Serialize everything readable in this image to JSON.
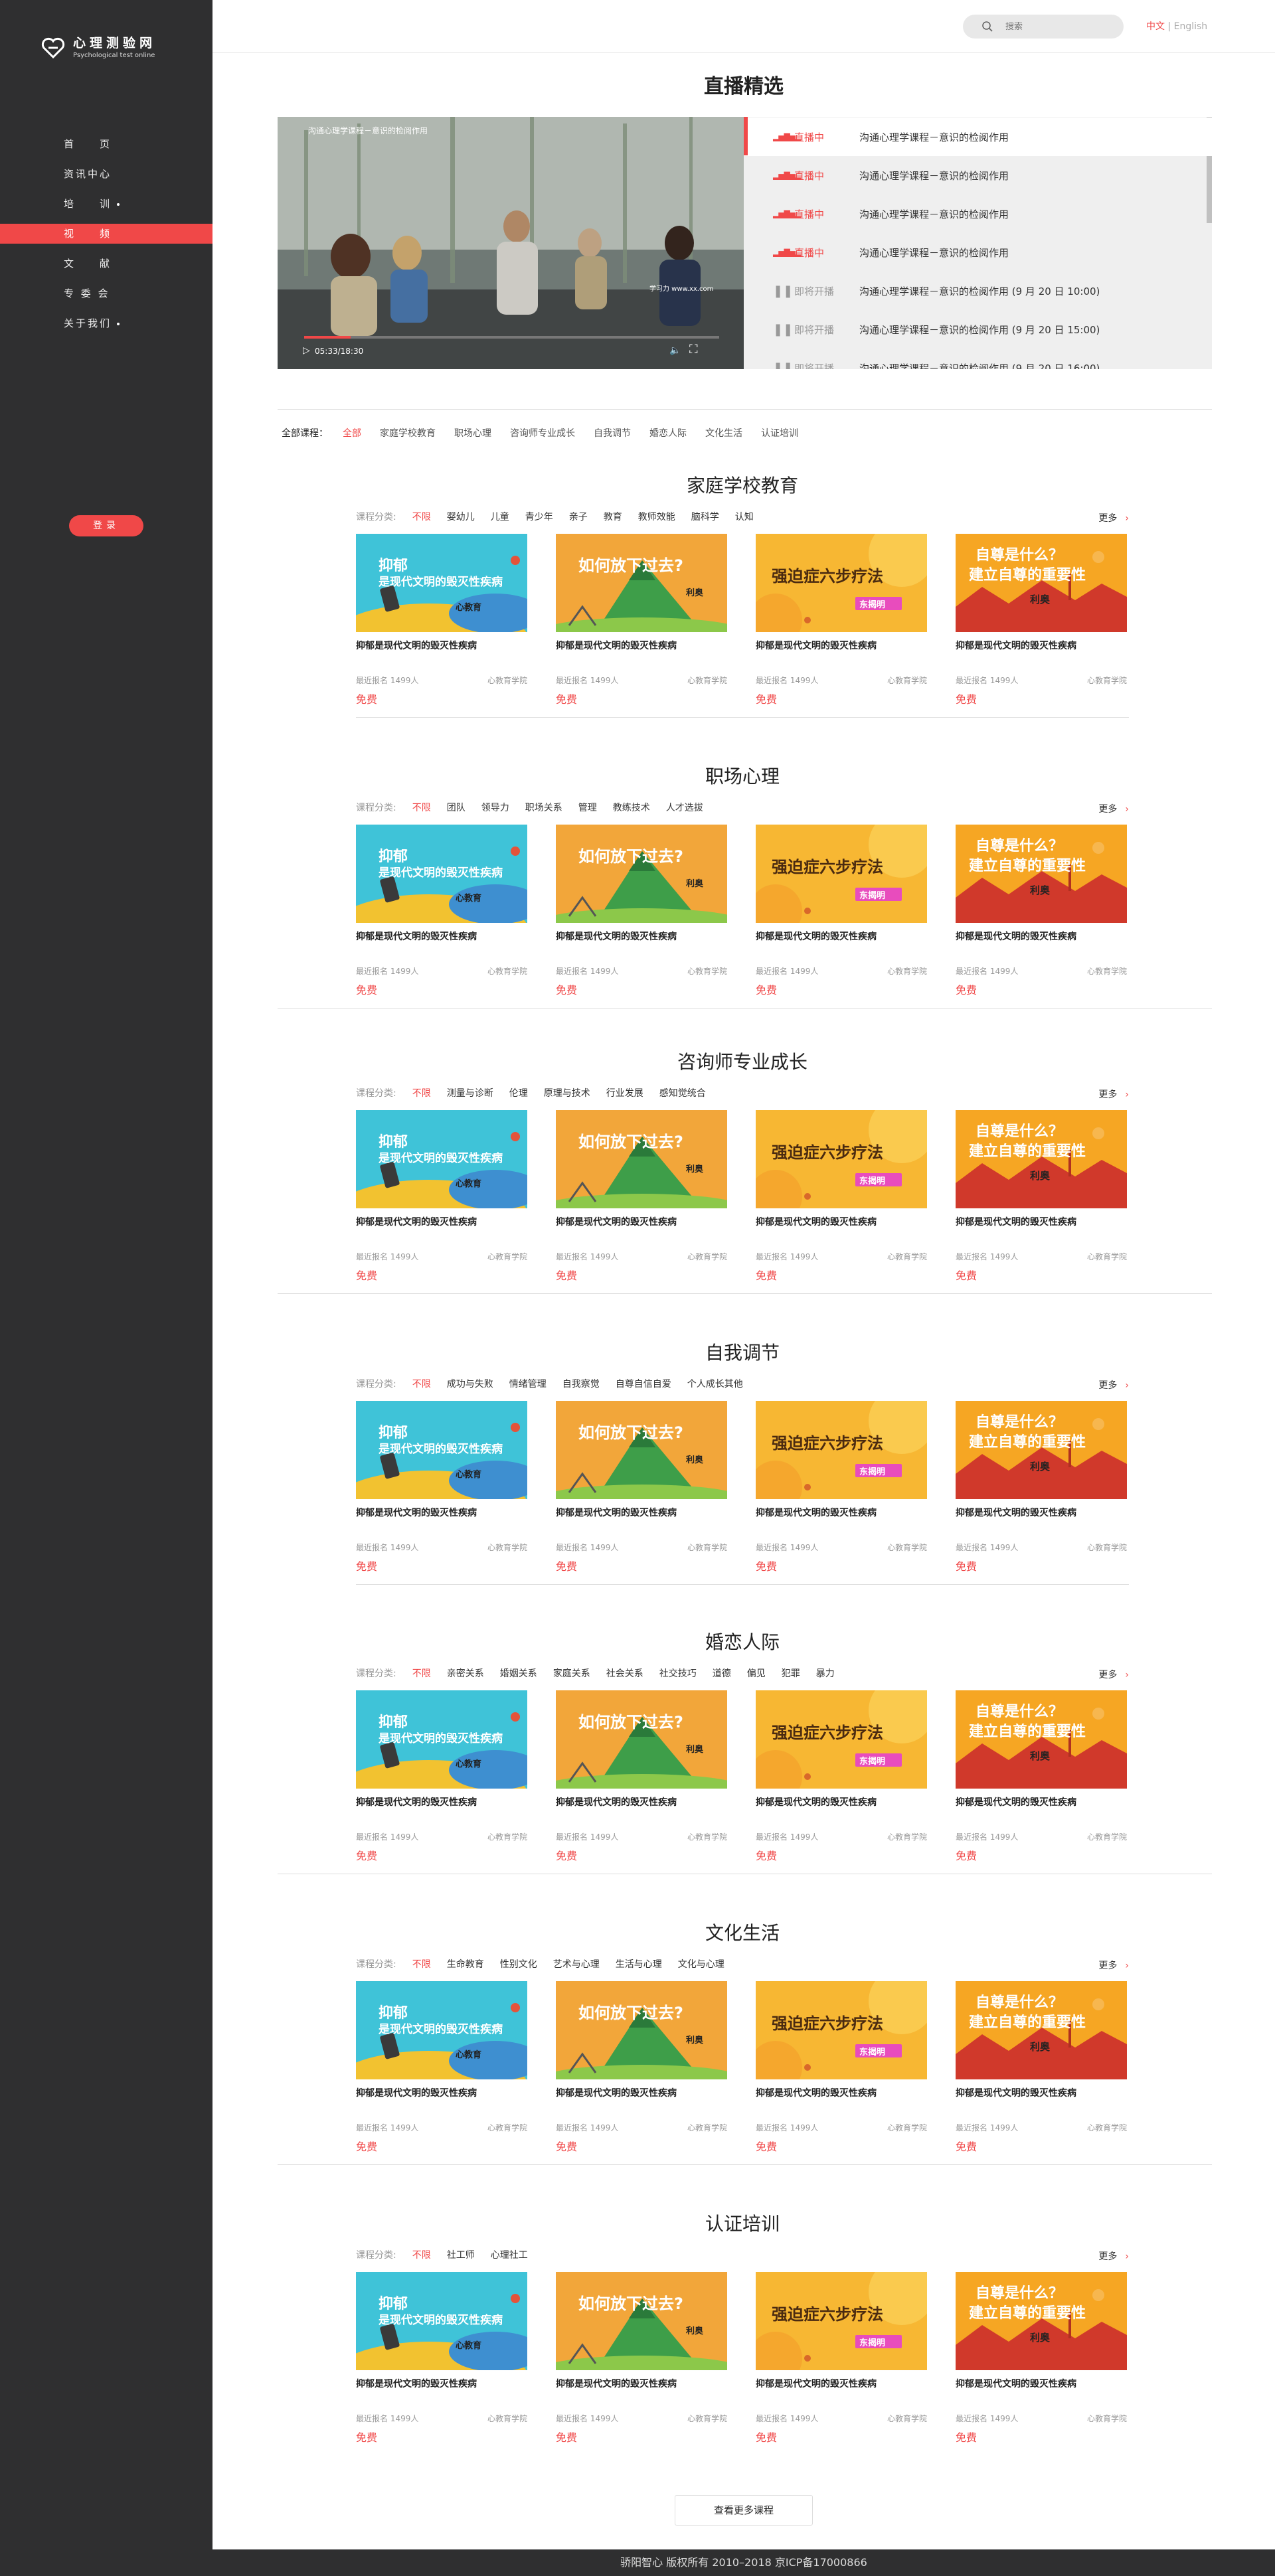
{
  "site": {
    "name": "心理测验网",
    "subtitle": "Psychological test online"
  },
  "nav": [
    {
      "label": "首　　页",
      "dot": false
    },
    {
      "label": "资讯中心",
      "dot": false
    },
    {
      "label": "培　　训",
      "dot": true
    },
    {
      "label": "视　　频",
      "dot": false,
      "active": true
    },
    {
      "label": "文　　献",
      "dot": false
    },
    {
      "label": "专 委 会",
      "dot": false
    },
    {
      "label": "关于我们",
      "dot": true
    }
  ],
  "login_label": "登录",
  "search": {
    "placeholder": "搜索"
  },
  "lang": {
    "zh": "中文",
    "sep": "|",
    "en": "English"
  },
  "live": {
    "title": "直播精选",
    "video_title": "沟通心理学课程－意识的检阅作用",
    "time": "05:33/18:30",
    "watermark": "学习力  www.xx.com",
    "items": [
      {
        "status": "直播中",
        "title": "沟通心理学课程－意识的检阅作用",
        "type": "live"
      },
      {
        "status": "直播中",
        "title": "沟通心理学课程－意识的检阅作用",
        "type": "live"
      },
      {
        "status": "直播中",
        "title": "沟通心理学课程－意识的检阅作用",
        "type": "live"
      },
      {
        "status": "直播中",
        "title": "沟通心理学课程－意识的检阅作用",
        "type": "live"
      },
      {
        "status": "即将开播",
        "title": "沟通心理学课程－意识的检阅作用 (9 月 20 日 10:00)",
        "type": "soon"
      },
      {
        "status": "即将开播",
        "title": "沟通心理学课程－意识的检阅作用 (9 月 20 日 15:00)",
        "type": "soon"
      },
      {
        "status": "即将开播",
        "title": "沟通心理学课程－意识的检阅作用 (9 月 20 日 16:00)",
        "type": "soon"
      }
    ]
  },
  "all_courses": {
    "label": "全部课程：",
    "items": [
      "全部",
      "家庭学校教育",
      "职场心理",
      "咨询师专业成长",
      "自我调节",
      "婚恋人际",
      "文化生活",
      "认证培训"
    ]
  },
  "course_card": {
    "title": "抑郁是现代文明的毁灭性疾病",
    "enroll": "最近报名 1499人",
    "org": "心教育学院",
    "price": "免费",
    "thumbs": [
      {
        "line1": "抑郁",
        "line2": "是现代文明的毁灭性疾病",
        "tag": "心教育"
      },
      {
        "line1": "如何放下过去?",
        "tag": "利奥"
      },
      {
        "line1": "强迫症六步疗法",
        "tag": "东揭明"
      },
      {
        "line1": "自尊是什么？",
        "line2": "建立自尊的重要性",
        "tag": "利奥"
      }
    ]
  },
  "cat_label": "课程分类:",
  "more_label": "更多",
  "sections": [
    {
      "title": "家庭学校教育",
      "cats": [
        "不限",
        "婴幼儿",
        "儿童",
        "青少年",
        "亲子",
        "教育",
        "教师效能",
        "脑科学",
        "认知"
      ]
    },
    {
      "title": "职场心理",
      "cats": [
        "不限",
        "团队",
        "领导力",
        "职场关系",
        "管理",
        "教练技术",
        "人才选拔"
      ]
    },
    {
      "title": "咨询师专业成长",
      "cats": [
        "不限",
        "测量与诊断",
        "伦理",
        "原理与技术",
        "行业发展",
        "感知觉统合"
      ]
    },
    {
      "title": "自我调节",
      "cats": [
        "不限",
        "成功与失败",
        "情绪管理",
        "自我察觉",
        "自尊自信自爱",
        "个人成长其他"
      ]
    },
    {
      "title": "婚恋人际",
      "cats": [
        "不限",
        "亲密关系",
        "婚姻关系",
        "家庭关系",
        "社会关系",
        "社交技巧",
        "道德",
        "偏见",
        "犯罪",
        "暴力"
      ]
    },
    {
      "title": "文化生活",
      "cats": [
        "不限",
        "生命教育",
        "性别文化",
        "艺术与心理",
        "生活与心理",
        "文化与心理"
      ]
    },
    {
      "title": "认证培训",
      "cats": [
        "不限",
        "社工师",
        "心理社工"
      ]
    }
  ],
  "more_courses": "查看更多课程",
  "footer": "骄阳智心 版权所有 2010–2018 京ICP备17000866",
  "colors": {
    "accent": "#f04848",
    "sidebar": "#2f2f30"
  }
}
